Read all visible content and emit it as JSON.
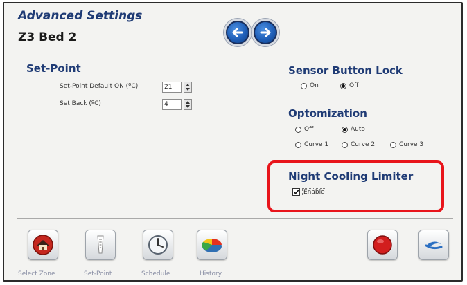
{
  "header": {
    "title": "Advanced Settings",
    "subtitle": "Z3 Bed 2",
    "prev_icon": "arrow-left-icon",
    "next_icon": "arrow-right-icon",
    "arrow_color": "#1f5fb8"
  },
  "setpoint": {
    "title": "Set-Point",
    "default_on_label": "Set-Point Default ON  (ºC)",
    "default_on_value": "21",
    "set_back_label": "Set Back (ºC)",
    "set_back_value": "4"
  },
  "sensor_lock": {
    "title": "Sensor Button Lock",
    "options": [
      {
        "label": "On",
        "checked": false
      },
      {
        "label": "Off",
        "checked": true
      }
    ]
  },
  "optimization": {
    "title": "Optomization",
    "options": [
      {
        "label": "Off",
        "checked": false
      },
      {
        "label": "Auto",
        "checked": true
      },
      {
        "label": "Curve 1",
        "checked": false
      },
      {
        "label": "Curve 2",
        "checked": false
      },
      {
        "label": "Curve 3",
        "checked": false
      }
    ]
  },
  "night_cooling": {
    "title": "Night Cooling Limiter",
    "enable_label": "Enable",
    "enabled": true,
    "highlight_color": "#e8141b"
  },
  "toolbar": {
    "items": [
      {
        "label": "Select Zone",
        "icon": "home-icon"
      },
      {
        "label": "Set-Point",
        "icon": "thermometer-icon"
      },
      {
        "label": "Schedule",
        "icon": "clock-icon"
      },
      {
        "label": "History",
        "icon": "pie-chart-icon"
      }
    ],
    "stop_icon": "stop-icon",
    "back_icon": "return-icon"
  },
  "colors": {
    "title_blue": "#1f3b75",
    "background": "#f3f3f1",
    "toolbar_label": "#8a8fa5"
  }
}
